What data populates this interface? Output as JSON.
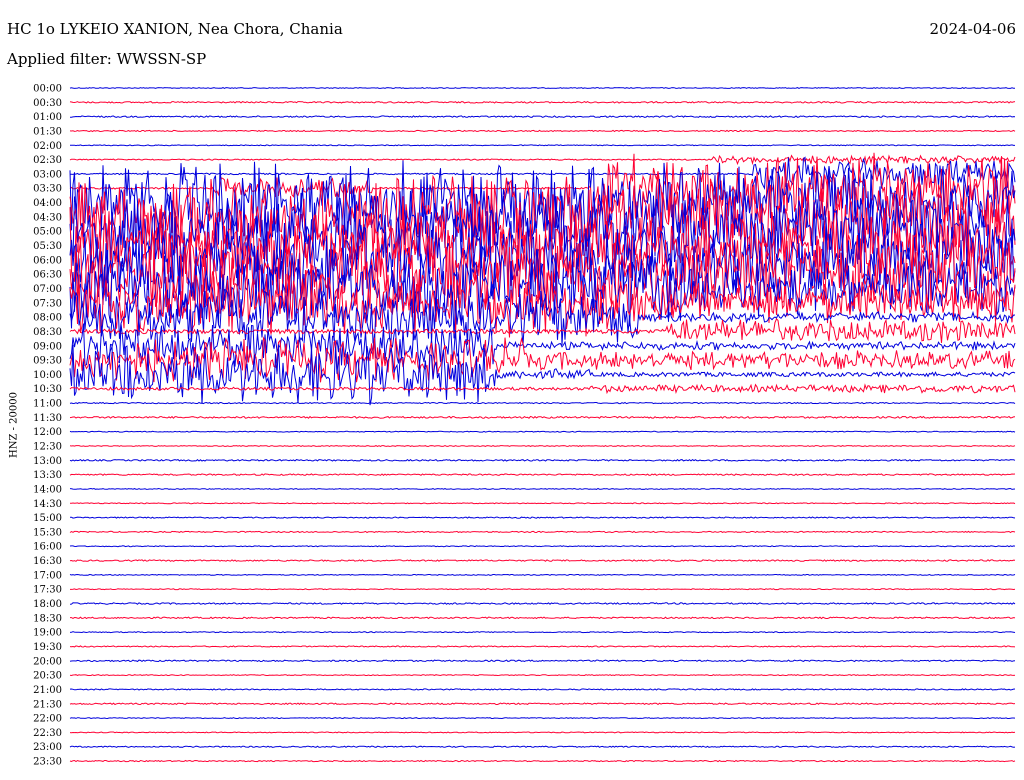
{
  "header": {
    "title": "HC 1o LYKEIO XANION, Nea Chora, Chania",
    "date": "2024-04-06",
    "filter": "Applied filter: WWSSN-SP"
  },
  "chart_data": {
    "type": "line",
    "title": "HC 1o LYKEIO XANION, Nea Chora, Chania",
    "ylabel": "HNZ - 20000",
    "colors": [
      "#0000dd",
      "#ff0033"
    ],
    "traces": [
      {
        "label": "00:00",
        "amp": 0.03,
        "segments": []
      },
      {
        "label": "00:30",
        "amp": 0.05,
        "segments": []
      },
      {
        "label": "01:00",
        "amp": 0.05,
        "segments": []
      },
      {
        "label": "01:30",
        "amp": 0.04,
        "segments": []
      },
      {
        "label": "02:00",
        "amp": 0.03,
        "segments": []
      },
      {
        "label": "02:30",
        "amp": 0.04,
        "segments": [
          [
            0.68,
            1.0,
            0.3
          ]
        ]
      },
      {
        "label": "03:00",
        "amp": 0.05,
        "segments": [
          [
            0.72,
            1.0,
            1.2
          ]
        ]
      },
      {
        "label": "03:30",
        "amp": 0.06,
        "segments": [
          [
            0.15,
            0.32,
            0.8
          ],
          [
            0.55,
            1.0,
            2.5
          ]
        ]
      },
      {
        "label": "04:00",
        "amp": 0.1,
        "segments": [
          [
            0.0,
            0.58,
            3.0
          ],
          [
            0.58,
            1.0,
            2.8
          ]
        ]
      },
      {
        "label": "04:30",
        "amp": 0.2,
        "segments": [
          [
            0.0,
            0.6,
            3.0
          ],
          [
            0.6,
            1.0,
            3.0
          ]
        ]
      },
      {
        "label": "05:00",
        "amp": 0.2,
        "segments": [
          [
            0.0,
            0.65,
            3.0
          ],
          [
            0.65,
            1.0,
            3.0
          ]
        ]
      },
      {
        "label": "05:30",
        "amp": 0.2,
        "segments": [
          [
            0.0,
            0.6,
            3.0
          ],
          [
            0.6,
            1.0,
            3.0
          ]
        ]
      },
      {
        "label": "06:00",
        "amp": 0.2,
        "segments": [
          [
            0.0,
            0.62,
            3.0
          ],
          [
            0.62,
            1.0,
            3.0
          ]
        ]
      },
      {
        "label": "06:30",
        "amp": 0.2,
        "segments": [
          [
            0.0,
            0.6,
            3.0
          ],
          [
            0.6,
            1.0,
            3.0
          ]
        ]
      },
      {
        "label": "07:00",
        "amp": 0.2,
        "segments": [
          [
            0.0,
            0.65,
            2.8
          ],
          [
            0.65,
            1.0,
            2.0
          ]
        ]
      },
      {
        "label": "07:30",
        "amp": 0.2,
        "segments": [
          [
            0.0,
            0.6,
            2.5
          ],
          [
            0.6,
            1.0,
            1.5
          ]
        ]
      },
      {
        "label": "08:00",
        "amp": 0.15,
        "segments": [
          [
            0.0,
            0.6,
            2.0
          ],
          [
            0.6,
            1.0,
            0.4
          ]
        ]
      },
      {
        "label": "08:30",
        "amp": 0.15,
        "segments": [
          [
            0.63,
            1.0,
            0.9
          ]
        ]
      },
      {
        "label": "09:00",
        "amp": 0.15,
        "segments": [
          [
            0.0,
            0.45,
            1.6
          ],
          [
            0.45,
            1.0,
            0.3
          ]
        ]
      },
      {
        "label": "09:30",
        "amp": 0.2,
        "segments": [
          [
            0.0,
            0.48,
            1.6
          ],
          [
            0.48,
            1.0,
            0.7
          ]
        ]
      },
      {
        "label": "10:00",
        "amp": 0.15,
        "segments": [
          [
            0.0,
            0.45,
            2.2
          ],
          [
            0.45,
            0.55,
            0.4
          ]
        ]
      },
      {
        "label": "10:30",
        "amp": 0.1,
        "segments": [
          [
            0.55,
            1.0,
            0.3
          ]
        ]
      },
      {
        "label": "11:00",
        "amp": 0.04,
        "segments": []
      },
      {
        "label": "11:30",
        "amp": 0.06,
        "segments": []
      },
      {
        "label": "12:00",
        "amp": 0.03,
        "segments": []
      },
      {
        "label": "12:30",
        "amp": 0.03,
        "segments": []
      },
      {
        "label": "13:00",
        "amp": 0.05,
        "segments": []
      },
      {
        "label": "13:30",
        "amp": 0.05,
        "segments": []
      },
      {
        "label": "14:00",
        "amp": 0.03,
        "segments": []
      },
      {
        "label": "14:30",
        "amp": 0.03,
        "segments": []
      },
      {
        "label": "15:00",
        "amp": 0.04,
        "segments": []
      },
      {
        "label": "15:30",
        "amp": 0.04,
        "segments": []
      },
      {
        "label": "16:00",
        "amp": 0.03,
        "segments": []
      },
      {
        "label": "16:30",
        "amp": 0.05,
        "segments": []
      },
      {
        "label": "17:00",
        "amp": 0.03,
        "segments": []
      },
      {
        "label": "17:30",
        "amp": 0.03,
        "segments": []
      },
      {
        "label": "18:00",
        "amp": 0.05,
        "segments": []
      },
      {
        "label": "18:30",
        "amp": 0.05,
        "segments": []
      },
      {
        "label": "19:00",
        "amp": 0.03,
        "segments": []
      },
      {
        "label": "19:30",
        "amp": 0.04,
        "segments": []
      },
      {
        "label": "20:00",
        "amp": 0.05,
        "segments": []
      },
      {
        "label": "20:30",
        "amp": 0.03,
        "segments": []
      },
      {
        "label": "21:00",
        "amp": 0.04,
        "segments": []
      },
      {
        "label": "21:30",
        "amp": 0.05,
        "segments": []
      },
      {
        "label": "22:00",
        "amp": 0.03,
        "segments": []
      },
      {
        "label": "22:30",
        "amp": 0.03,
        "segments": []
      },
      {
        "label": "23:00",
        "amp": 0.04,
        "segments": []
      },
      {
        "label": "23:30",
        "amp": 0.04,
        "segments": []
      }
    ]
  }
}
